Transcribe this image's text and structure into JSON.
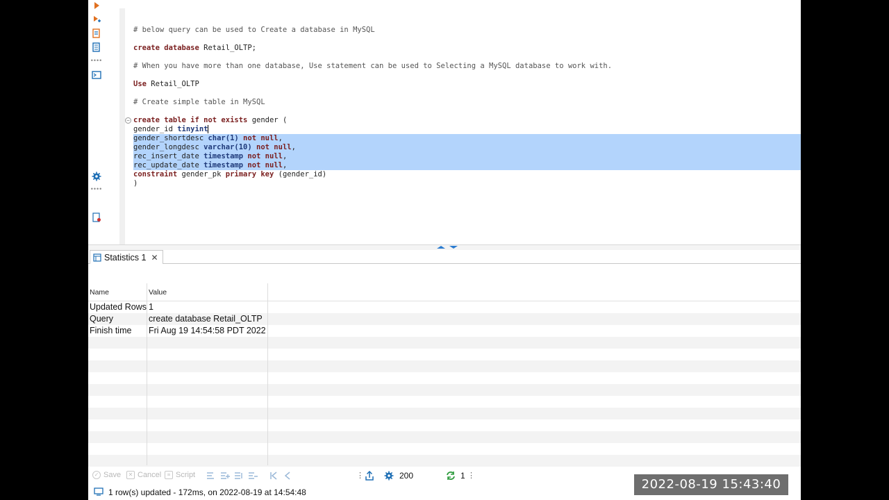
{
  "editor": {
    "lines": [
      {
        "comment": "# below query can be used to Create a database in MySQL"
      },
      {
        "blank": true
      },
      {
        "kw": "create database",
        "rest": " Retail_OLTP;"
      },
      {
        "blank": true
      },
      {
        "comment": "# When you have more than one database, Use statement can be used to Selecting a MySQL database to work with."
      },
      {
        "blank": true
      },
      {
        "kw": "Use",
        "rest": " Retail_OLTP"
      },
      {
        "blank": true
      },
      {
        "comment": "# Create simple table in MySQL"
      },
      {
        "blank": true
      },
      {
        "kw": "create table if not exists",
        "rest": " gender ("
      },
      {
        "plain": "gender_id ",
        "type": "tinyint",
        "tail": ""
      },
      {
        "plain": "gender_shortdesc ",
        "type": "char(1)",
        "kw2": " not null",
        "tail": ",",
        "selected": true
      },
      {
        "plain": "gender_longdesc ",
        "type": "varchar(10)",
        "kw2": " not null",
        "tail": ",",
        "selected": true
      },
      {
        "plain": "rec_insert_date ",
        "type": "timestamp",
        "kw2": " not null",
        "tail": ",",
        "selected": true
      },
      {
        "plain": "rec_update_date ",
        "type": "timestamp",
        "kw2": " not null",
        "tail": ",",
        "selected": true
      },
      {
        "kw": "constraint",
        "rest": " gender_pk ",
        "kw3": "primary key",
        "tail": " (gender_id)"
      },
      {
        "plain": ")"
      }
    ]
  },
  "results": {
    "tab_label": "Statistics 1",
    "columns": [
      "Name",
      "Value"
    ],
    "rows": [
      {
        "name": "Updated Rows",
        "value": "1"
      },
      {
        "name": "Query",
        "value": "create database Retail_OLTP"
      },
      {
        "name": "Finish time",
        "value": "Fri Aug 19 14:54:58 PDT 2022"
      }
    ]
  },
  "toolbar": {
    "save_label": "Save",
    "cancel_label": "Cancel",
    "script_label": "Script",
    "fetch_size": "200",
    "refresh_count": "1"
  },
  "status": {
    "message": "1 row(s) updated - 172ms, on 2022-08-19 at 14:54:48"
  },
  "overlay": {
    "timestamp": "2022-08-19 15:43:40"
  },
  "colors": {
    "keyword": "#7a1f1f",
    "type": "#1f3a7a",
    "selection": "#b3d4fc",
    "accent_icon": "#1e6fb5"
  }
}
